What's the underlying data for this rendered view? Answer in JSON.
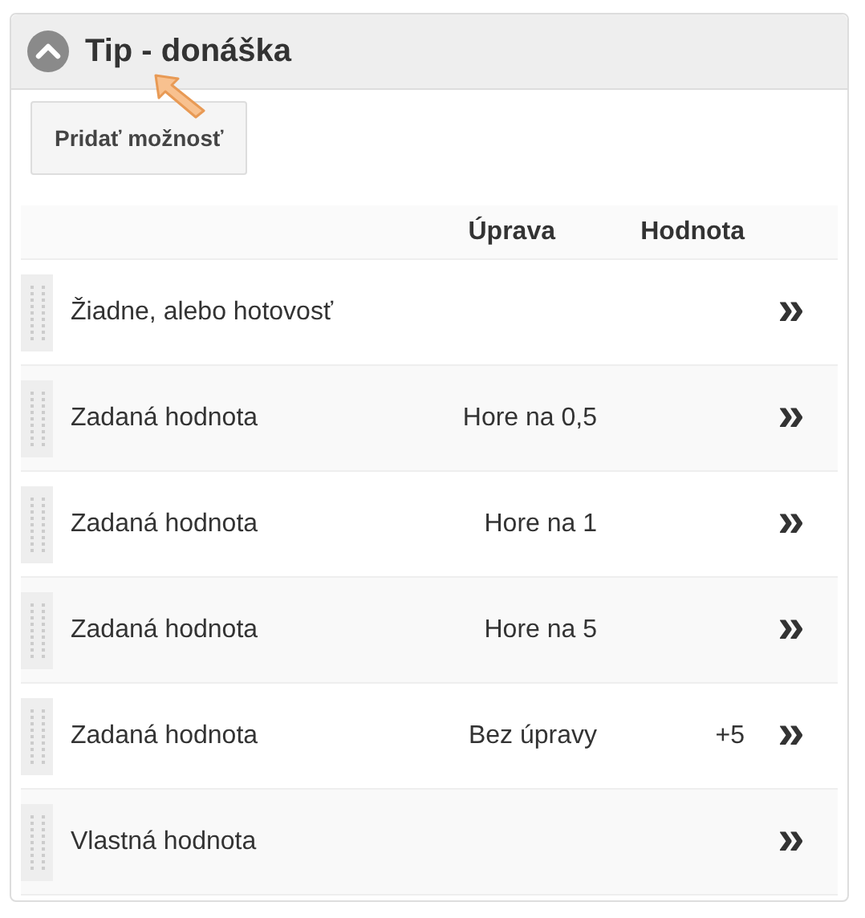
{
  "panel": {
    "title": "Tip - donáška",
    "expanded": true
  },
  "add_button": "Pridať možnosť",
  "table": {
    "columns": [
      "Úprava",
      "Hodnota"
    ],
    "rows": [
      {
        "name": "Žiadne, alebo hotovosť",
        "adjustment": "",
        "value": "",
        "action": "»"
      },
      {
        "name": "Zadaná hodnota",
        "adjustment": "Hore na 0,5",
        "value": "",
        "action": "»"
      },
      {
        "name": "Zadaná hodnota",
        "adjustment": "Hore na 1",
        "value": "",
        "action": "»"
      },
      {
        "name": "Zadaná hodnota",
        "adjustment": "Hore na 5",
        "value": "",
        "action": "»"
      },
      {
        "name": "Zadaná hodnota",
        "adjustment": "Bez úpravy",
        "value": "+5",
        "action": "»"
      },
      {
        "name": "Vlastná hodnota",
        "adjustment": "",
        "value": "",
        "action": "»"
      }
    ]
  }
}
